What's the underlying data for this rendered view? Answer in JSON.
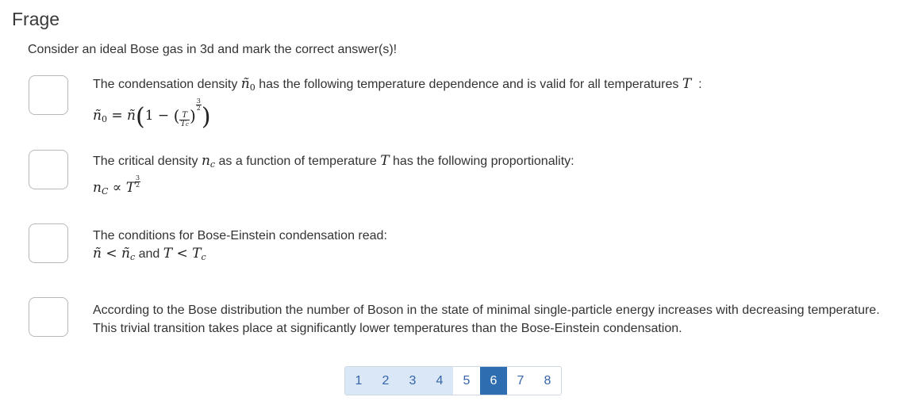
{
  "header": {
    "title": "Frage"
  },
  "question": {
    "text": "Consider an ideal Bose gas in 3d and mark the correct answer(s)!"
  },
  "options": [
    {
      "text_a": "The condensation density",
      "text_b": "has the following temperature dependence and is valid for all temperatures",
      "text_c": ":",
      "checked": false
    },
    {
      "text_a": "The critical density",
      "text_b": "as a function of temperature",
      "text_c": "has the following proportionality:",
      "checked": false
    },
    {
      "text_a": "The conditions for Bose-Einstein condensation read:",
      "text_and": "and",
      "checked": false
    },
    {
      "line1": "According to the Bose distribution the number of Boson in the state of minimal single-particle energy increases with decreasing temperature.",
      "line2": "This trivial transition takes place at significantly lower temperatures than the Bose-Einstein condensation.",
      "checked": false
    }
  ],
  "pagination": {
    "pages": [
      "1",
      "2",
      "3",
      "4",
      "5",
      "6",
      "7",
      "8"
    ],
    "current": "6"
  },
  "colors": {
    "current_page_bg": "#2e6db0",
    "visited_page_bg": "#d9e7f7",
    "link_color": "#3565a8"
  }
}
